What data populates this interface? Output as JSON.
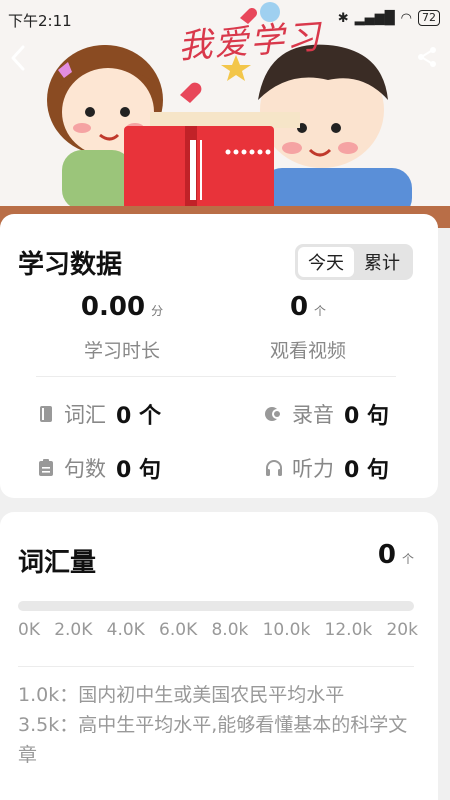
{
  "status": {
    "time": "下午2:11",
    "battery": "72"
  },
  "hero": {
    "title": "我爱学习"
  },
  "stats": {
    "title": "学习数据",
    "tabs": [
      {
        "label": "今天",
        "active": true
      },
      {
        "label": "累计",
        "active": false
      }
    ],
    "study_time": {
      "value": "0.00",
      "unit": "分",
      "label": "学习时长"
    },
    "videos": {
      "value": "0",
      "unit": "个",
      "label": "观看视频"
    },
    "vocab": {
      "label": "词汇",
      "value": "0 个"
    },
    "recording": {
      "label": "录音",
      "value": "0 句"
    },
    "sentences": {
      "label": "句数",
      "value": "0 句"
    },
    "listening": {
      "label": "听力",
      "value": "0 句"
    }
  },
  "vocabulary": {
    "title": "词汇量",
    "count": "0",
    "unit": "个",
    "progress": 0,
    "ticks": [
      "0K",
      "2.0K",
      "4.0K",
      "6.0K",
      "8.0k",
      "10.0k",
      "12.0k",
      "20k"
    ],
    "notes": [
      "1.0k：国内初中生或美国农民平均水平",
      "3.5k：高中生平均水平,能够看懂基本的科学文章"
    ]
  },
  "colors": {
    "accent": "#f0b33c",
    "title_red": "#d9384b"
  }
}
